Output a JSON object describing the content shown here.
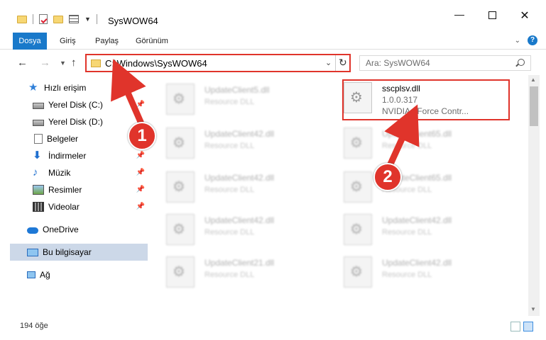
{
  "window": {
    "title": "SysWOW64",
    "minimize": "—",
    "close": "✕"
  },
  "ribbon": {
    "tabs": [
      "Dosya",
      "Giriş",
      "Paylaş",
      "Görünüm"
    ],
    "help": "?"
  },
  "address": {
    "path": "C:\\Windows\\SysWOW64",
    "search_placeholder": "Ara: SysWOW64"
  },
  "sidebar": {
    "items": [
      {
        "label": "Hızlı erişim",
        "icon": "star-icon"
      },
      {
        "label": "Yerel Disk (C:)",
        "icon": "drive-icon",
        "pinned": true
      },
      {
        "label": "Yerel Disk (D:)",
        "icon": "drive-icon"
      },
      {
        "label": "Belgeler",
        "icon": "documents-icon",
        "pinned": true
      },
      {
        "label": "İndirmeler",
        "icon": "downloads-icon",
        "pinned": true
      },
      {
        "label": "Müzik",
        "icon": "music-icon",
        "pinned": true
      },
      {
        "label": "Resimler",
        "icon": "pictures-icon",
        "pinned": true
      },
      {
        "label": "Videolar",
        "icon": "videos-icon",
        "pinned": true
      },
      {
        "label": "OneDrive",
        "icon": "cloud-icon"
      },
      {
        "label": "Bu bilgisayar",
        "icon": "computer-icon",
        "selected": true
      },
      {
        "label": "Ağ",
        "icon": "network-icon"
      }
    ]
  },
  "files": {
    "selected": {
      "name": "sscplsv.dll",
      "version": "1.0.0.317",
      "description": "NVIDIA nForce Contr..."
    },
    "others": [
      {
        "name": "UpdateClient5.dll",
        "type": "Resource DLL"
      },
      {
        "name": "UpdateClient42.dll",
        "type": "Resource DLL"
      },
      {
        "name": "UpdateClient65.dll",
        "type": "Resource DLL"
      },
      {
        "name": "UpdateClient42.dll",
        "type": "Resource DLL"
      },
      {
        "name": "UpdateClient65.dll",
        "type": "Resource DLL"
      },
      {
        "name": "UpdateClient42.dll",
        "type": "Resource DLL"
      },
      {
        "name": "UpdateClient42.dll",
        "type": "Resource DLL"
      },
      {
        "name": "UpdateClient21.dll",
        "type": "Resource DLL"
      },
      {
        "name": "UpdateClient42.dll",
        "type": "Resource DLL"
      }
    ]
  },
  "status": {
    "count": "194 öğe"
  },
  "annotations": {
    "badge1": "1",
    "badge2": "2",
    "color": "#e0342b"
  }
}
